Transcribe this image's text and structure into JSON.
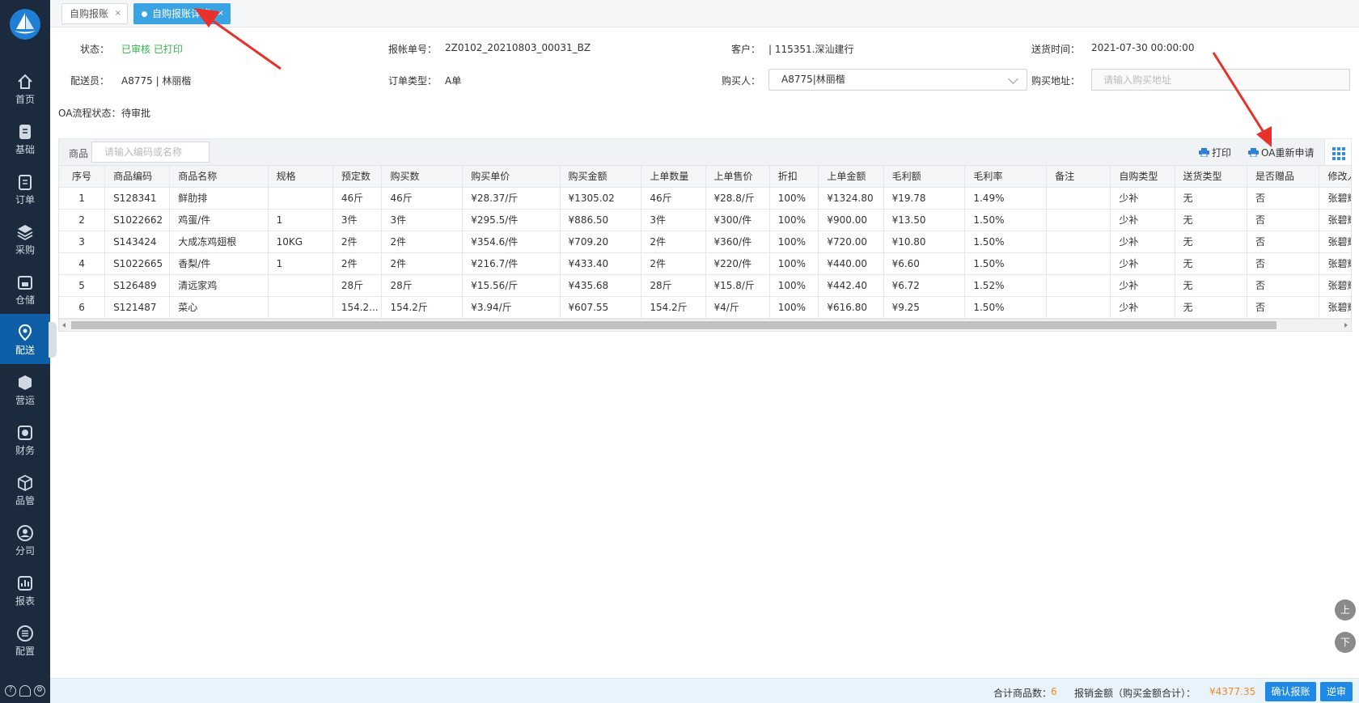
{
  "colors": {
    "sidebar_bg": "#1b2a3c",
    "accent": "#1f8ae6",
    "active_tab": "#3aa3e3",
    "status_green": "#2fb44a",
    "amount_orange": "#f08a24",
    "annotation_red": "#e8312a"
  },
  "sidebar": {
    "items": [
      {
        "label": "首页",
        "icon": "home-icon"
      },
      {
        "label": "基础",
        "icon": "document-icon"
      },
      {
        "label": "订单",
        "icon": "clipboard-icon"
      },
      {
        "label": "采购",
        "icon": "layers-icon"
      },
      {
        "label": "仓储",
        "icon": "warehouse-icon"
      },
      {
        "label": "配送",
        "icon": "location-pin-icon",
        "active": true
      },
      {
        "label": "营运",
        "icon": "cube-icon"
      },
      {
        "label": "财务",
        "icon": "finance-icon"
      },
      {
        "label": "品管",
        "icon": "box-icon"
      },
      {
        "label": "分司",
        "icon": "user-circle-icon"
      },
      {
        "label": "报表",
        "icon": "bar-chart-icon"
      },
      {
        "label": "配置",
        "icon": "settings-list-icon"
      }
    ]
  },
  "tabs": [
    {
      "label": "自购报账",
      "active": false
    },
    {
      "label": "自购报账详情",
      "active": true
    }
  ],
  "info": {
    "status_label": "状态：",
    "status_value": "已审核 已打印",
    "bill_no_label": "报帐单号：",
    "bill_no_value": "2Z0102_20210803_00031_BZ",
    "customer_label": "客户：",
    "customer_value": "| 115351.深汕建行",
    "delivery_time_label": "送货时间：",
    "delivery_time_value": "2021-07-30 00:00:00",
    "courier_label": "配送员：",
    "courier_value": "A8775 | 林丽楷",
    "order_type_label": "订单类型：",
    "order_type_value": "A单",
    "buyer_label": "购买人：",
    "buyer_value": "A8775|林丽楷",
    "address_label": "购买地址：",
    "address_placeholder": "请输入购买地址",
    "oa_label": "OA流程状态：",
    "oa_value": "待审批"
  },
  "toolbar": {
    "product_label": "商品",
    "search_placeholder": "请输入编码或名称",
    "print_label": "打印",
    "oa_reapply_label": "OA重新申请"
  },
  "table": {
    "headers": [
      "序号",
      "商品编码",
      "商品名称",
      "规格",
      "预定数",
      "购买数",
      "购买单价",
      "购买金额",
      "上单数量",
      "上单售价",
      "折扣",
      "上单金额",
      "毛利额",
      "毛利率",
      "备注",
      "自购类型",
      "送货类型",
      "是否赠品",
      "修改人"
    ],
    "rows": [
      [
        "1",
        "S128341",
        "鲜肋排",
        "",
        "46斤",
        "46斤",
        "¥28.37/斤",
        "¥1305.02",
        "46斤",
        "¥28.8/斤",
        "100%",
        "¥1324.80",
        "¥19.78",
        "1.49%",
        "",
        "少补",
        "无",
        "否",
        "张碧辉"
      ],
      [
        "2",
        "S1022662",
        "鸡蛋/件",
        "1",
        "3件",
        "3件",
        "¥295.5/件",
        "¥886.50",
        "3件",
        "¥300/件",
        "100%",
        "¥900.00",
        "¥13.50",
        "1.50%",
        "",
        "少补",
        "无",
        "否",
        "张碧辉"
      ],
      [
        "3",
        "S143424",
        "大成冻鸡翅根",
        "10KG",
        "2件",
        "2件",
        "¥354.6/件",
        "¥709.20",
        "2件",
        "¥360/件",
        "100%",
        "¥720.00",
        "¥10.80",
        "1.50%",
        "",
        "少补",
        "无",
        "否",
        "张碧辉"
      ],
      [
        "4",
        "S1022665",
        "香梨/件",
        "1",
        "2件",
        "2件",
        "¥216.7/件",
        "¥433.40",
        "2件",
        "¥220/件",
        "100%",
        "¥440.00",
        "¥6.60",
        "1.50%",
        "",
        "少补",
        "无",
        "否",
        "张碧辉"
      ],
      [
        "5",
        "S126489",
        "清远家鸡",
        "",
        "28斤",
        "28斤",
        "¥15.56/斤",
        "¥435.68",
        "28斤",
        "¥15.8/斤",
        "100%",
        "¥442.40",
        "¥6.72",
        "1.52%",
        "",
        "少补",
        "无",
        "否",
        "张碧辉"
      ],
      [
        "6",
        "S121487",
        "菜心",
        "",
        "154.2...",
        "154.2斤",
        "¥3.94/斤",
        "¥607.55",
        "154.2斤",
        "¥4/斤",
        "100%",
        "¥616.80",
        "¥9.25",
        "1.50%",
        "",
        "少补",
        "无",
        "否",
        "张碧辉"
      ]
    ]
  },
  "float": {
    "up_label": "上",
    "down_label": "下"
  },
  "footer": {
    "count_label": "合计商品数：",
    "count_value": "6",
    "amount_label": "报销金额（购买金额合计）：",
    "amount_value": "¥4377.35",
    "confirm_label": "确认报账",
    "reverse_label": "逆审"
  }
}
